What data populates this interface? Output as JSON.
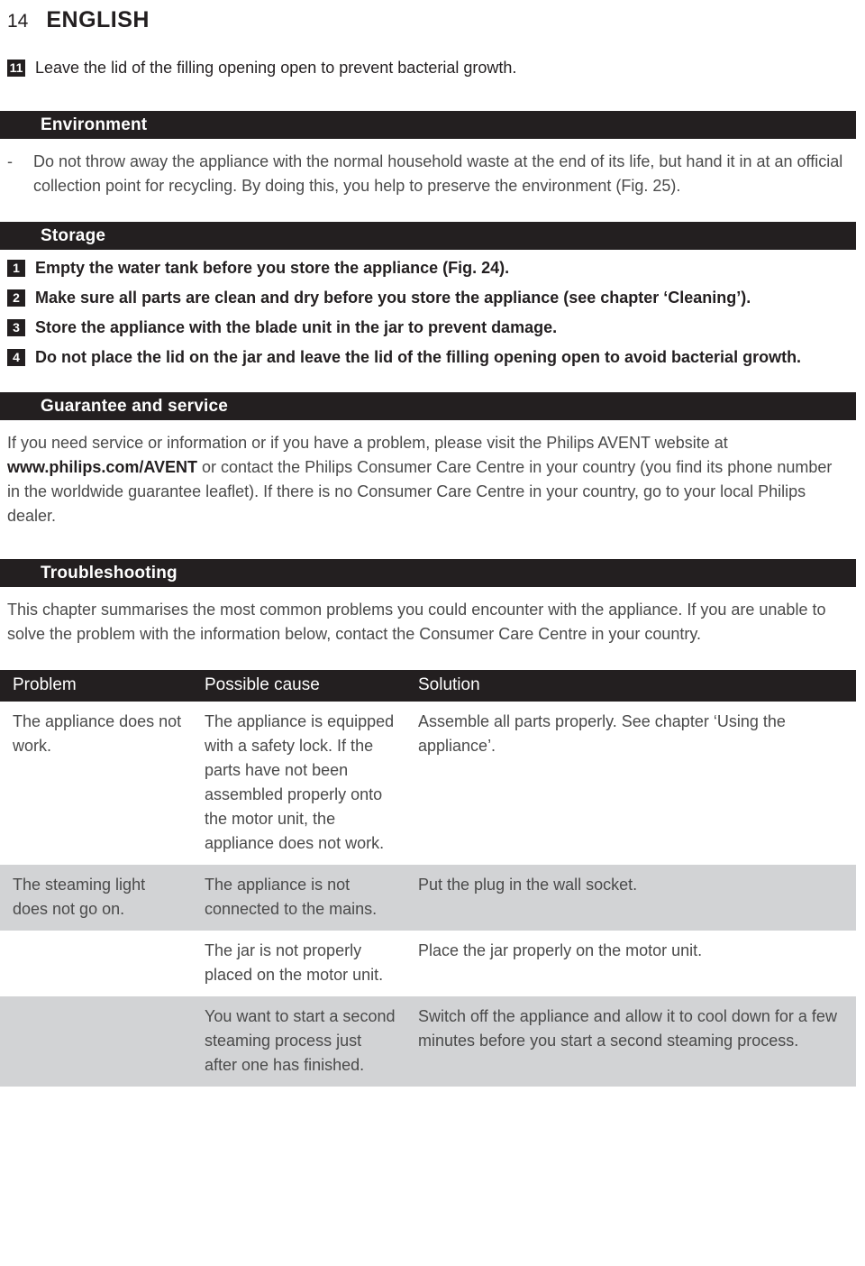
{
  "page": {
    "number": "14",
    "language": "ENGLISH"
  },
  "top_step": {
    "number": "11",
    "text": "Leave the lid of the filling opening open to prevent bacterial growth."
  },
  "sections": {
    "environment": {
      "title": "Environment",
      "bullet_marker": "-",
      "body": "Do not throw away the appliance with the normal household waste at the end of its life, but hand it in at an official collection point for recycling. By doing this, you help to preserve the environment (Fig. 25)."
    },
    "storage": {
      "title": "Storage",
      "steps": [
        {
          "number": "1",
          "text": "Empty the water tank before you store the appliance (Fig. 24)."
        },
        {
          "number": "2",
          "text": "Make sure all parts are clean and dry before you store the appliance (see chapter ‘Cleaning’)."
        },
        {
          "number": "3",
          "text": "Store the appliance with the blade unit in the jar to prevent damage."
        },
        {
          "number": "4",
          "text": "Do not place the lid on the jar and leave the lid of the filling opening open to avoid bacterial growth."
        }
      ]
    },
    "guarantee": {
      "title": "Guarantee and service",
      "body_part1": "If you need service or information or if you have a problem, please visit the Philips AVENT website at ",
      "website": "www.philips.com/AVENT",
      "body_part2": " or contact the Philips Consumer Care Centre in your country (you find its phone number in the worldwide guarantee leaflet). If there is no Consumer Care Centre in your country, go to your local Philips dealer."
    },
    "troubleshooting": {
      "title": "Troubleshooting",
      "intro": "This chapter summarises the most common problems you could encounter with the appliance. If you are unable to solve the problem with the information below, contact the Consumer Care Centre in your country.",
      "table": {
        "headers": [
          "Problem",
          "Possible cause",
          "Solution"
        ],
        "rows": [
          {
            "shaded": false,
            "problem": "The appliance does not work.",
            "cause": "The appliance is equipped with a safety lock. If the parts have not been assembled properly onto the motor unit, the appliance does not work.",
            "solution": "Assemble all parts properly. See chapter ‘Using the appliance’."
          },
          {
            "shaded": true,
            "problem": "The steaming light does not go on.",
            "cause": "The appliance is not connected to the mains.",
            "solution": "Put the plug in the wall socket."
          },
          {
            "shaded": false,
            "problem": "",
            "cause": "The jar is not properly placed on the motor unit.",
            "solution": "Place the jar properly on the motor unit."
          },
          {
            "shaded": true,
            "problem": "",
            "cause": "You want to start a second steaming process just after one has finished.",
            "solution": "Switch off the appliance and allow it to cool down for a few minutes before you start a second steaming process."
          }
        ]
      }
    }
  },
  "colors": {
    "ink": "#231f20",
    "body_text": "#4a4a4a",
    "bar_bg": "#231f20",
    "bar_text": "#ffffff",
    "row_shade": "#d2d3d5",
    "page_bg": "#ffffff"
  }
}
